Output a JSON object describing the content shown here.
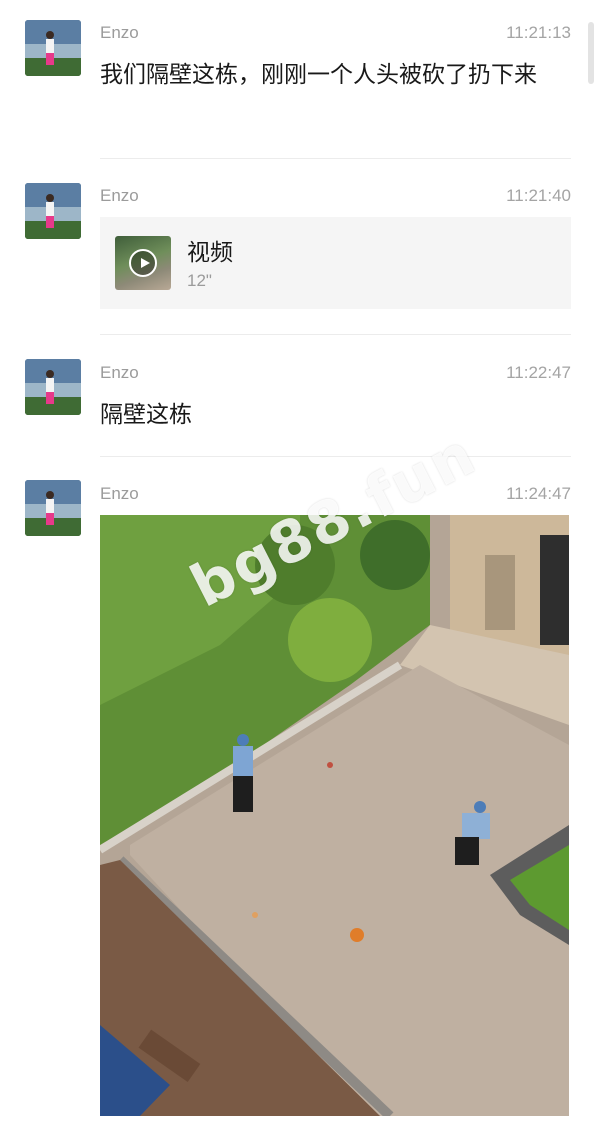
{
  "messages": [
    {
      "sender": "Enzo",
      "time": "11:21:13",
      "text": "我们隔壁这栋，刚刚一个人头被砍了扔下来"
    },
    {
      "sender": "Enzo",
      "time": "11:21:40",
      "video": {
        "label": "视频",
        "duration": "12\""
      }
    },
    {
      "sender": "Enzo",
      "time": "11:22:47",
      "text": "隔壁这栋"
    },
    {
      "sender": "Enzo",
      "time": "11:24:47",
      "image": {
        "watermark": "bg88.fun"
      }
    }
  ],
  "icons": {
    "play": "play-icon"
  },
  "colors": {
    "sender": "#9b9b9b",
    "time": "#a4a4a4",
    "text": "#191919",
    "divider": "#ececec",
    "card_bg": "#f5f5f5"
  }
}
